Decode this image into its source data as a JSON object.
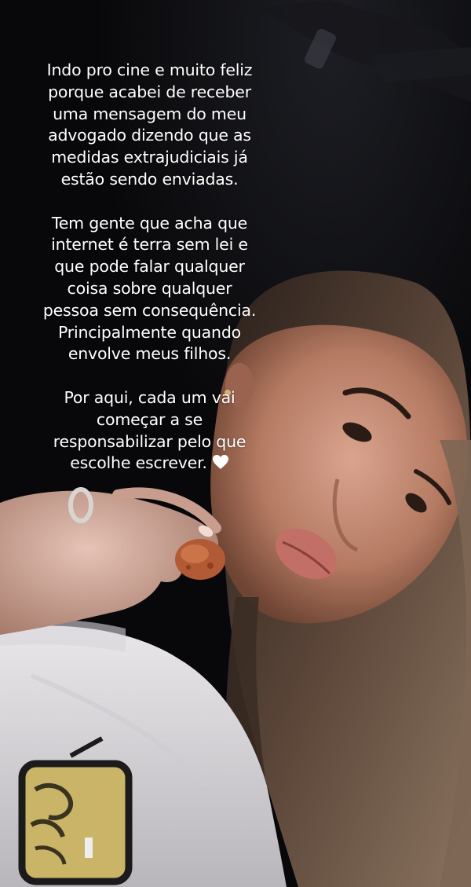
{
  "story": {
    "paragraphs": [
      {
        "lines": [
          "Indo pro cine e muito feliz",
          "porque acabei de receber",
          "uma mensagem do meu",
          "advogado dizendo que as",
          "medidas extrajudiciais já",
          "estão sendo enviadas."
        ]
      },
      {
        "lines": [
          "Tem gente que acha que",
          "internet é terra sem lei e",
          "que pode falar qualquer",
          "coisa sobre qualquer",
          "pessoa sem consequência.",
          "Principalmente quando",
          "envolve meus filhos."
        ]
      },
      {
        "lines": [
          "Por aqui, cada um vai",
          "começar a se",
          "responsabilizar pelo que",
          "escolhe escrever."
        ]
      }
    ],
    "end_icon": "white-heart-icon",
    "colors": {
      "text": "#ffffff",
      "background": "#0a0a0c",
      "sunglasses_lens": "#c9b467"
    }
  }
}
